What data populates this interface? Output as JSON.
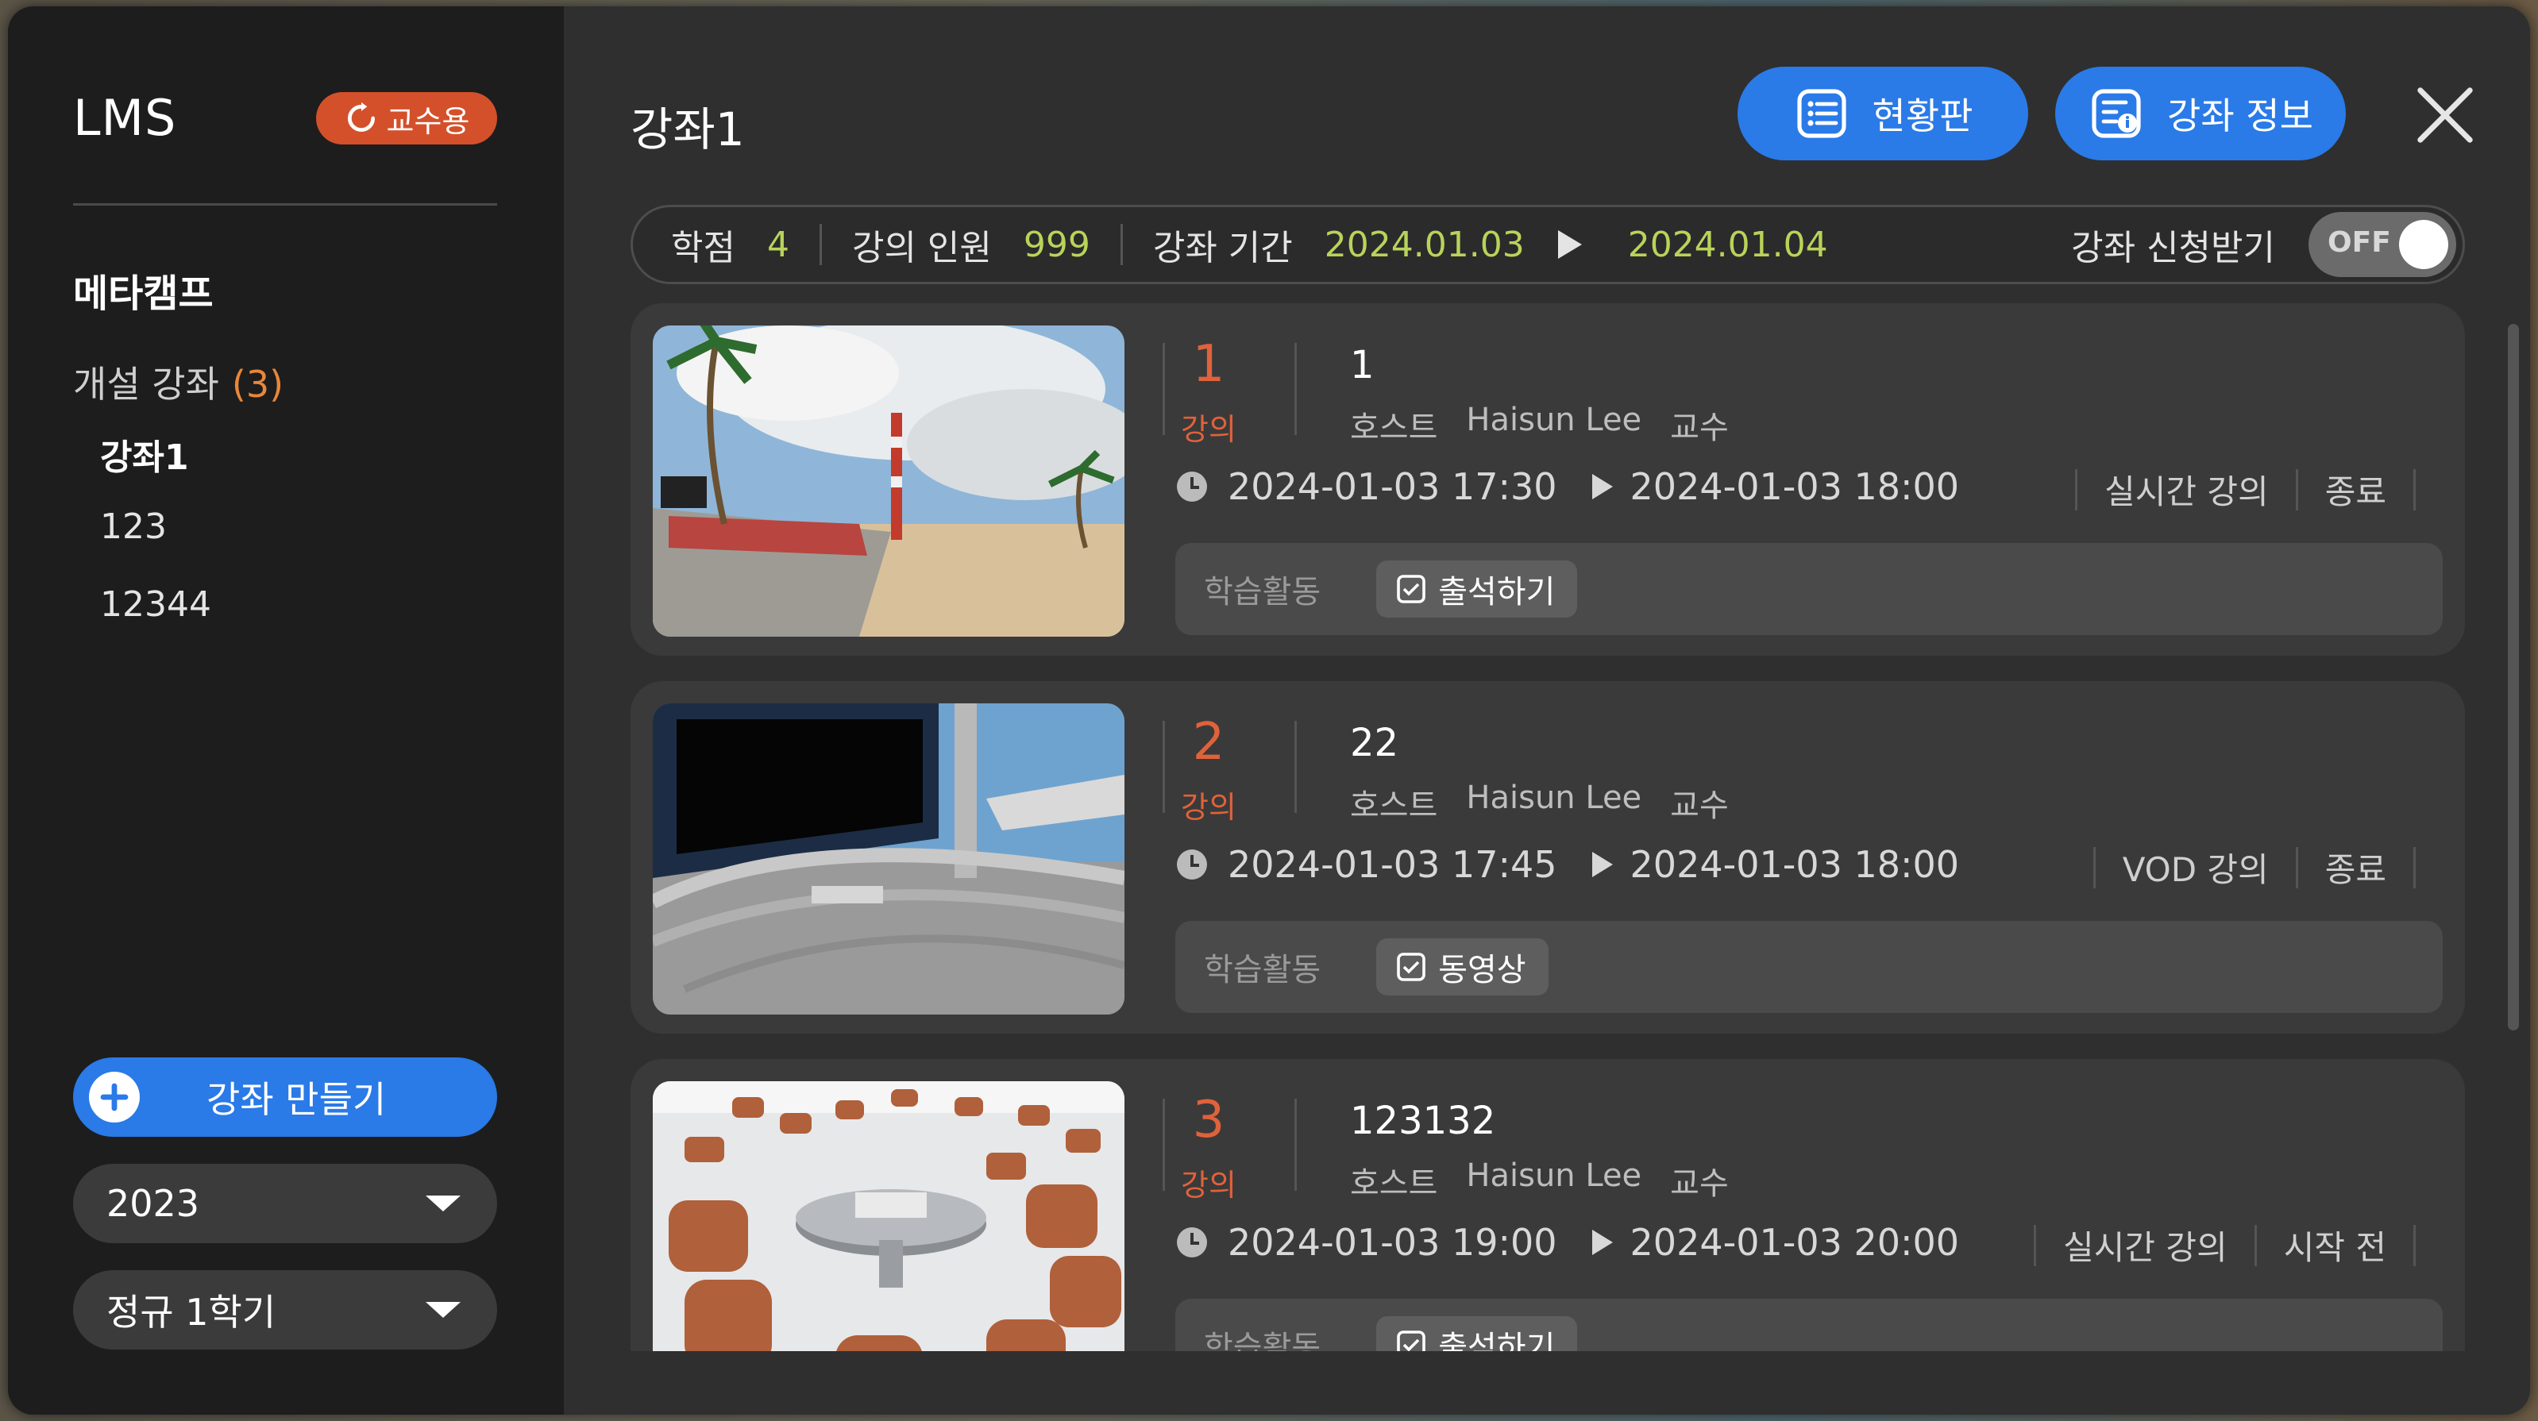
{
  "app": {
    "title": "LMS",
    "role_badge": "교수용"
  },
  "sidebar": {
    "camp_title": "메타캠프",
    "open_courses_label": "개설 강좌",
    "open_courses_count": "(3)",
    "courses": [
      "강좌1",
      "123",
      "12344"
    ],
    "active_course_index": 0,
    "create_button": "강좌 만들기",
    "year_select": "2023",
    "semester_select": "정규 1학기"
  },
  "header": {
    "title": "강좌1",
    "dashboard_button": "현황판",
    "course_info_button": "강좌 정보"
  },
  "info_bar": {
    "credit_label": "학점",
    "credit_value": "4",
    "capacity_label": "강의 인원",
    "capacity_value": "999",
    "period_label": "강좌 기간",
    "period_start": "2024.01.03",
    "period_end": "2024.01.04",
    "enroll_label": "강좌 신청받기",
    "enroll_toggle": "OFF"
  },
  "lectures": [
    {
      "number": "1",
      "number_label": "강의",
      "title": "1",
      "host_label": "호스트",
      "host_name": "Haisun Lee",
      "host_role": "교수",
      "start": "2024-01-03 17:30",
      "end": "2024-01-03 18:00",
      "type": "실시간 강의",
      "status": "종료",
      "activity_label": "학습활동",
      "activity_chip": "출석하기"
    },
    {
      "number": "2",
      "number_label": "강의",
      "title": "22",
      "host_label": "호스트",
      "host_name": "Haisun Lee",
      "host_role": "교수",
      "start": "2024-01-03 17:45",
      "end": "2024-01-03 18:00",
      "type": "VOD 강의",
      "status": "종료",
      "activity_label": "학습활동",
      "activity_chip": "동영상"
    },
    {
      "number": "3",
      "number_label": "강의",
      "title": "123132",
      "host_label": "호스트",
      "host_name": "Haisun Lee",
      "host_role": "교수",
      "start": "2024-01-03 19:00",
      "end": "2024-01-03 20:00",
      "type": "실시간 강의",
      "status": "시작 전",
      "activity_label": "학습활동",
      "activity_chip": "출석하기"
    }
  ],
  "colors": {
    "accent": "#2a7ae8",
    "badge": "#d4502a",
    "number": "#e0623a",
    "date_green": "#b9d35a"
  }
}
